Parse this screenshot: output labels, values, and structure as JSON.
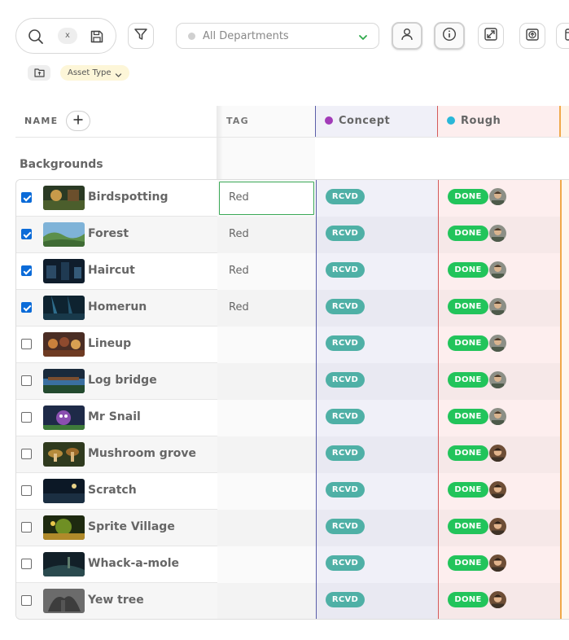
{
  "toolbar": {
    "clear_label": "x",
    "department_select": "All Departments"
  },
  "filters": {
    "asset_type_chip": "Asset Type"
  },
  "table": {
    "name_header": "NAME",
    "tag_header": "TAG",
    "stages": [
      {
        "label": "Concept",
        "color": "#a23bb8"
      },
      {
        "label": "Rough",
        "color": "#2ab7d8"
      }
    ],
    "group": "Backgrounds",
    "rows": [
      {
        "name": "Birdspotting",
        "checked": true,
        "tag": "Red",
        "concept": "RCVD",
        "rough": "DONE"
      },
      {
        "name": "Forest",
        "checked": true,
        "tag": "Red",
        "concept": "RCVD",
        "rough": "DONE"
      },
      {
        "name": "Haircut",
        "checked": true,
        "tag": "Red",
        "concept": "RCVD",
        "rough": "DONE"
      },
      {
        "name": "Homerun",
        "checked": true,
        "tag": "Red",
        "concept": "RCVD",
        "rough": "DONE"
      },
      {
        "name": "Lineup",
        "checked": false,
        "tag": "",
        "concept": "RCVD",
        "rough": "DONE"
      },
      {
        "name": "Log bridge",
        "checked": false,
        "tag": "",
        "concept": "RCVD",
        "rough": "DONE"
      },
      {
        "name": "Mr Snail",
        "checked": false,
        "tag": "",
        "concept": "RCVD",
        "rough": "DONE"
      },
      {
        "name": "Mushroom grove",
        "checked": false,
        "tag": "",
        "concept": "RCVD",
        "rough": "DONE"
      },
      {
        "name": "Scratch",
        "checked": false,
        "tag": "",
        "concept": "RCVD",
        "rough": "DONE"
      },
      {
        "name": "Sprite Village",
        "checked": false,
        "tag": "",
        "concept": "RCVD",
        "rough": "DONE"
      },
      {
        "name": "Whack-a-mole",
        "checked": false,
        "tag": "",
        "concept": "RCVD",
        "rough": "DONE"
      },
      {
        "name": "Yew tree",
        "checked": false,
        "tag": "",
        "concept": "RCVD",
        "rough": "DONE"
      }
    ]
  },
  "colors": {
    "rcvd": "#4fb0a6",
    "done": "#22c45b",
    "checkbox": "#0b6bd8",
    "concept_border": "#5a5ea8",
    "rough_border": "#d45a5a",
    "next_border": "#f0a94a"
  }
}
